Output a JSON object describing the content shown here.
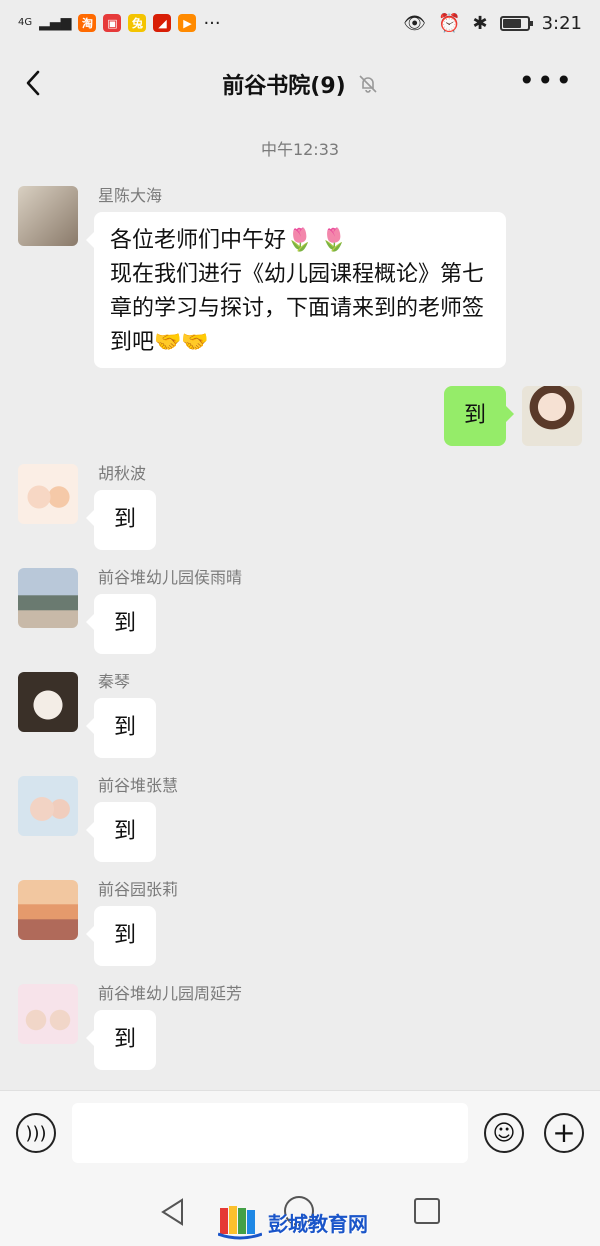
{
  "status": {
    "network": "4G",
    "time": "3:21"
  },
  "header": {
    "title": "前谷书院(9)"
  },
  "chat": {
    "timestamp": "中午12:33",
    "messages": [
      {
        "sender": "星陈大海",
        "text": "各位老师们中午好🌷 🌷\n现在我们进行《幼儿园课程概论》第七章的学习与探讨，下面请来到的老师签到吧🤝🤝"
      },
      {
        "sender": "",
        "text": "到",
        "mine": true
      },
      {
        "sender": "胡秋波",
        "text": "到"
      },
      {
        "sender": "前谷堆幼儿园侯雨晴",
        "text": "到"
      },
      {
        "sender": "秦琴",
        "text": "到"
      },
      {
        "sender": "前谷堆张慧",
        "text": "到"
      },
      {
        "sender": "前谷园张莉",
        "text": "到"
      },
      {
        "sender": "前谷堆幼儿园周延芳",
        "text": "到"
      }
    ]
  },
  "input": {
    "placeholder": ""
  },
  "watermark": {
    "text": "彭城教育网"
  },
  "colors": {
    "background": "#ededed",
    "my_bubble": "#95ec69",
    "other_bubble": "#ffffff"
  }
}
